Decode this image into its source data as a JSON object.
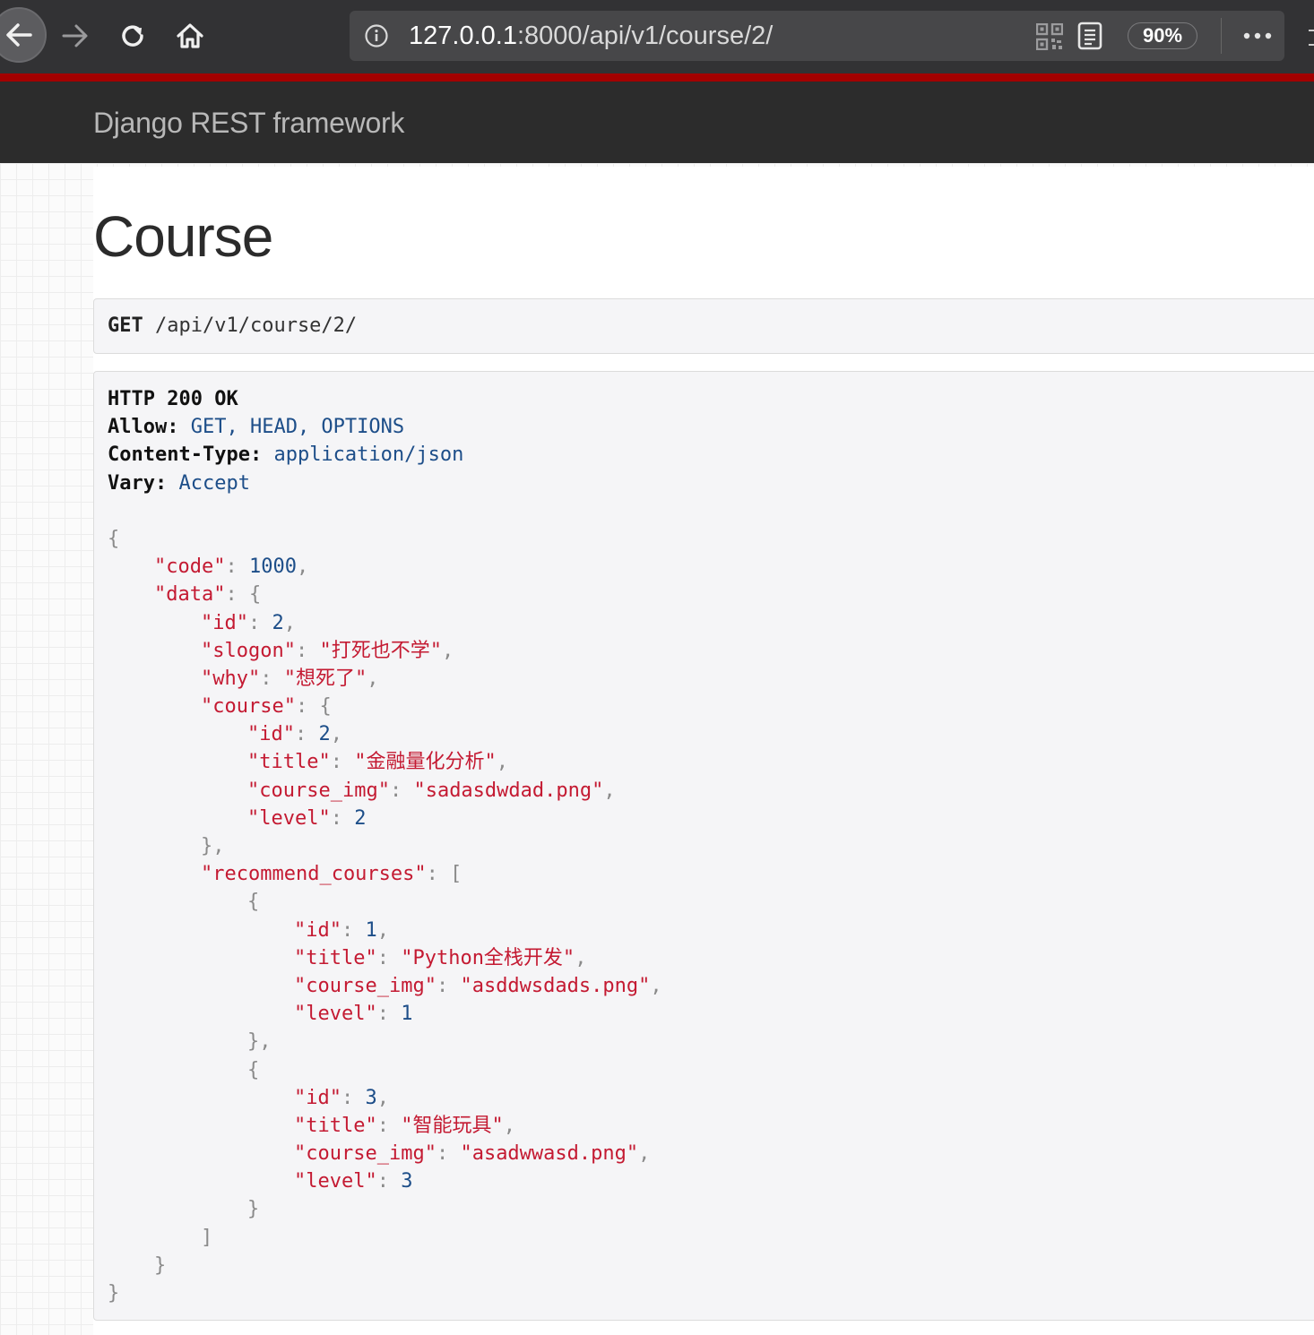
{
  "browser": {
    "url_host": "127.0.0.1",
    "url_path": ":8000/api/v1/course/2/",
    "zoom": "90%"
  },
  "app": {
    "brand": "Django REST framework"
  },
  "page": {
    "title": "Course"
  },
  "request": {
    "method": "GET",
    "path": "/api/v1/course/2/"
  },
  "response": {
    "status_line": "HTTP 200 OK",
    "headers": [
      {
        "key": "Allow",
        "value": "GET, HEAD, OPTIONS"
      },
      {
        "key": "Content-Type",
        "value": "application/json"
      },
      {
        "key": "Vary",
        "value": "Accept"
      }
    ],
    "body": {
      "code": "1000",
      "data": {
        "id": "2",
        "slogon": "\"打死也不学\"",
        "why": "\"想死了\"",
        "course": {
          "id": "2",
          "title": "\"金融量化分析\"",
          "course_img": "\"sadasdwdad.png\"",
          "level": "2"
        },
        "recommend_courses": [
          {
            "id": "1",
            "title": "\"Python全栈开发\"",
            "course_img": "\"asddwsdads.png\"",
            "level": "1"
          },
          {
            "id": "3",
            "title": "\"智能玩具\"",
            "course_img": "\"asadwwasd.png\"",
            "level": "3"
          }
        ]
      }
    }
  },
  "icons": {
    "back": "arrow-left-icon",
    "forward": "arrow-right-icon",
    "reload": "reload-icon",
    "home": "home-icon",
    "info": "info-icon",
    "qr": "qr-code-icon",
    "reader": "reader-view-icon",
    "menu": "more-horizontal-icon"
  }
}
